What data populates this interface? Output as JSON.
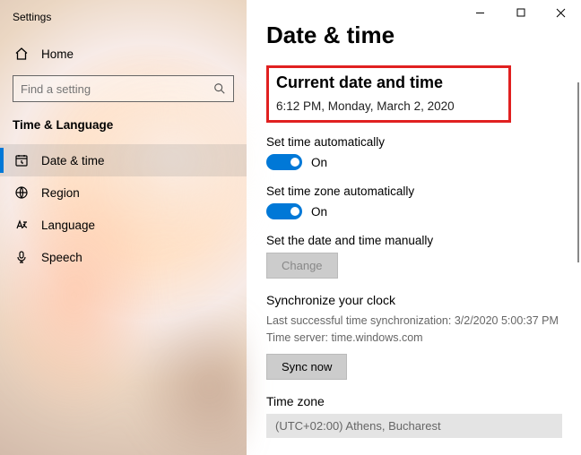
{
  "app_title": "Settings",
  "home_label": "Home",
  "search_placeholder": "Find a setting",
  "section_title": "Time & Language",
  "nav": {
    "date_time": "Date & time",
    "region": "Region",
    "language": "Language",
    "speech": "Speech"
  },
  "page": {
    "title": "Date & time",
    "current_heading": "Current date and time",
    "current_value": "6:12 PM, Monday, March 2, 2020",
    "auto_time_label": "Set time automatically",
    "auto_time_state": "On",
    "auto_tz_label": "Set time zone automatically",
    "auto_tz_state": "On",
    "manual_label": "Set the date and time manually",
    "change_btn": "Change",
    "sync_heading": "Synchronize your clock",
    "sync_last": "Last successful time synchronization: 3/2/2020 5:00:37 PM",
    "sync_server": "Time server: time.windows.com",
    "sync_btn": "Sync now",
    "tz_heading": "Time zone",
    "tz_value": "(UTC+02:00) Athens, Bucharest"
  }
}
